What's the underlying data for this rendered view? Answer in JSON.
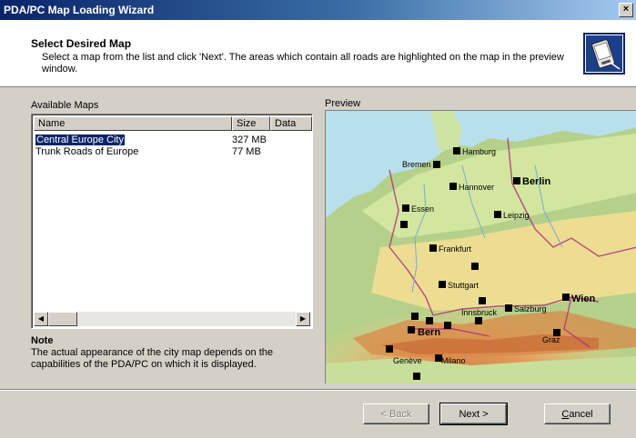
{
  "window": {
    "title": "PDA/PC Map Loading Wizard",
    "close_glyph": "×"
  },
  "header": {
    "title": "Select Desired Map",
    "description": "Select a map from the list and click 'Next'. The areas which contain all roads are highlighted on the map in the preview window.",
    "icon": "pda-device-icon"
  },
  "maps": {
    "label": "Available Maps",
    "columns": [
      "Name",
      "Size",
      "Data"
    ],
    "rows": [
      {
        "name": "Central Europe City",
        "size": "327 MB",
        "selected": true
      },
      {
        "name": "Trunk Roads of Europe",
        "size": "77 MB",
        "selected": false
      }
    ]
  },
  "note": {
    "title": "Note",
    "text": "The actual appearance of the city map depends on the capabilities of the PDA/PC on which it is displayed."
  },
  "preview": {
    "label": "Preview",
    "cities": [
      "Hamburg",
      "Bremen",
      "Hannover",
      "Berlin",
      "Essen",
      "Leipzig",
      "Frankfurt",
      "Stuttgart",
      "Wien",
      "Innsbruck",
      "Salzburg",
      "Bern",
      "Graz",
      "Genève",
      "Milano"
    ]
  },
  "buttons": {
    "back": "< Back",
    "next": "Next >",
    "cancel_prefix": "",
    "cancel_mn": "C",
    "cancel_rest": "ancel"
  },
  "colors": {
    "title_bar": "#0a246a",
    "selection": "#0a246a",
    "face": "#d4d0c8"
  }
}
